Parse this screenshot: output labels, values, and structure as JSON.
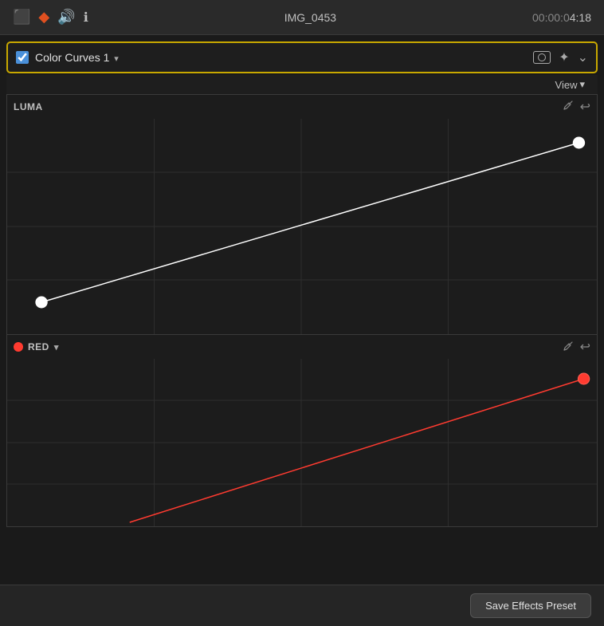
{
  "toolbar": {
    "title": "IMG_0453",
    "time_static": "00:00:0",
    "time_accent": "4:18",
    "icons": [
      "film-icon",
      "prism-icon",
      "speaker-icon",
      "info-icon"
    ]
  },
  "effect_header": {
    "checkbox_checked": true,
    "name": "Color Curves 1",
    "chevron": "▾",
    "mask_icon": "mask-icon",
    "sparkle_icon": "✦",
    "chevron_down": "⌄"
  },
  "view_row": {
    "label": "View",
    "chevron": "▾"
  },
  "luma_panel": {
    "label": "LUMA",
    "eyedropper_icon": "eyedropper",
    "reset_icon": "↩"
  },
  "red_panel": {
    "label": "RED",
    "chevron": "▾",
    "eyedropper_icon": "eyedropper",
    "reset_icon": "↩"
  },
  "bottom_bar": {
    "save_button": "Save Effects Preset"
  }
}
